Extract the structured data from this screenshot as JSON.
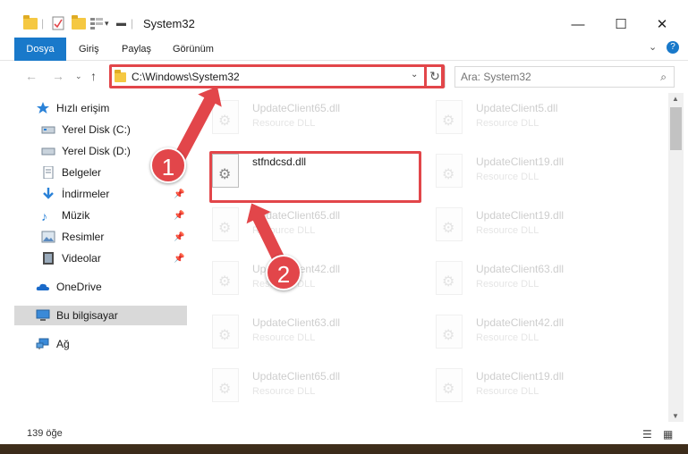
{
  "window": {
    "title": "System32"
  },
  "ribbon": {
    "tabs": [
      {
        "label": "Dosya"
      },
      {
        "label": "Giriş"
      },
      {
        "label": "Paylaş"
      },
      {
        "label": "Görünüm"
      }
    ]
  },
  "address": {
    "path": "C:\\Windows\\System32"
  },
  "search": {
    "placeholder": "Ara: System32"
  },
  "sidebar": {
    "items": [
      {
        "label": "Hızlı erişim",
        "icon": "star-icon"
      },
      {
        "label": "Yerel Disk (C:)",
        "icon": "drive-icon"
      },
      {
        "label": "Yerel Disk (D:)",
        "icon": "drive-icon"
      },
      {
        "label": "Belgeler",
        "icon": "document-icon"
      },
      {
        "label": "İndirmeler",
        "icon": "download-icon"
      },
      {
        "label": "Müzik",
        "icon": "music-icon"
      },
      {
        "label": "Resimler",
        "icon": "pictures-icon"
      },
      {
        "label": "Videolar",
        "icon": "video-icon"
      },
      {
        "label": "OneDrive",
        "icon": "cloud-icon"
      },
      {
        "label": "Bu bilgisayar",
        "icon": "computer-icon"
      },
      {
        "label": "Ağ",
        "icon": "network-icon"
      }
    ]
  },
  "files": {
    "highlighted": {
      "name": "stfndcsd.dll",
      "type": ""
    },
    "left": [
      {
        "name": "UpdateClient65.dll",
        "type": "Resource DLL"
      },
      {
        "name": "UpdateClient65.dll",
        "type": "Resource DLL"
      },
      {
        "name": "UpdateClient42.dll",
        "type": "Resource DLL"
      },
      {
        "name": "UpdateClient63.dll",
        "type": "Resource DLL"
      },
      {
        "name": "UpdateClient65.dll",
        "type": "Resource DLL"
      }
    ],
    "right": [
      {
        "name": "UpdateClient5.dll",
        "type": "Resource DLL"
      },
      {
        "name": "UpdateClient19.dll",
        "type": "Resource DLL"
      },
      {
        "name": "UpdateClient19.dll",
        "type": "Resource DLL"
      },
      {
        "name": "UpdateClient63.dll",
        "type": "Resource DLL"
      },
      {
        "name": "UpdateClient42.dll",
        "type": "Resource DLL"
      },
      {
        "name": "UpdateClient19.dll",
        "type": "Resource DLL"
      }
    ]
  },
  "status": {
    "count": "139 öğe"
  },
  "annotations": {
    "step1": "1",
    "step2": "2"
  },
  "colors": {
    "accent": "#1979ca",
    "highlight": "#e2464a",
    "selected": "#d9d9d9"
  }
}
